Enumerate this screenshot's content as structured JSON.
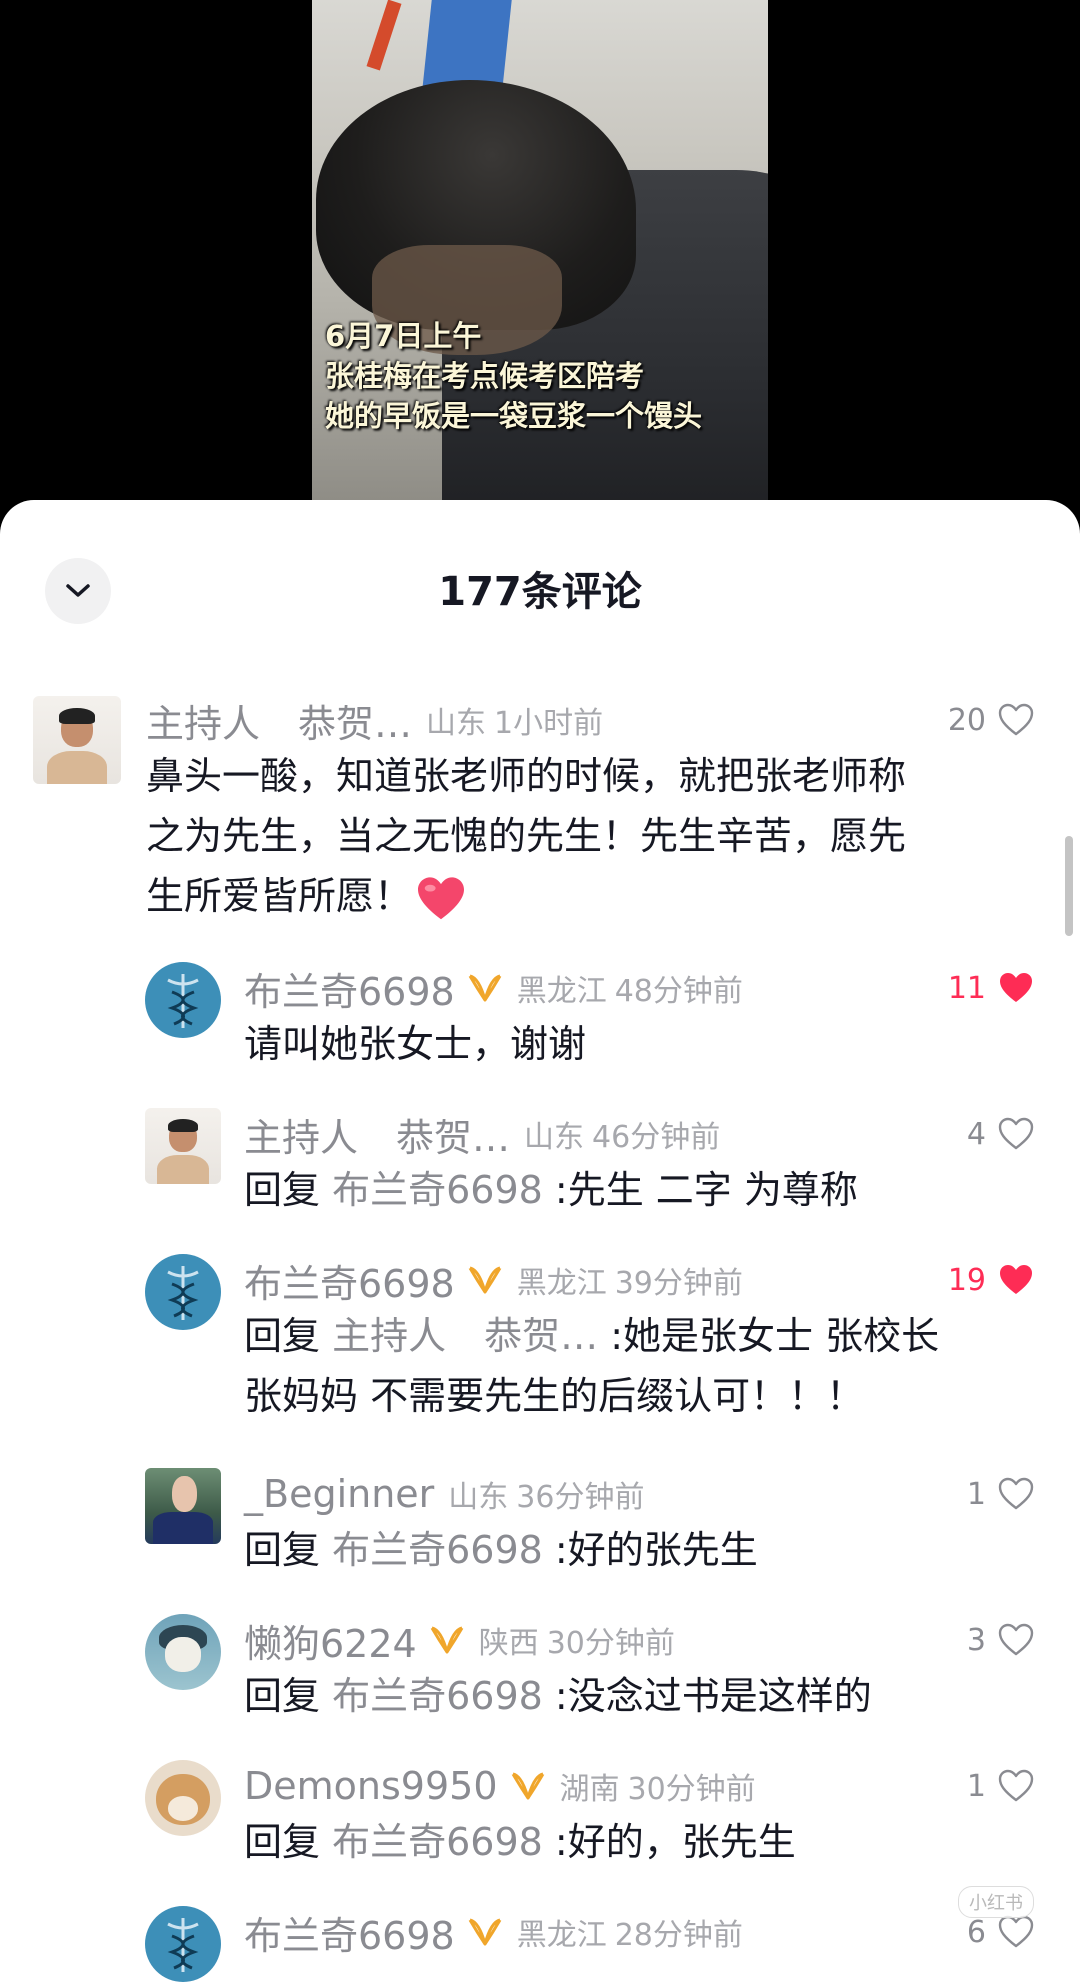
{
  "video": {
    "caption_lines": [
      "6月7日上午",
      "张桂梅在考点候考区陪考",
      "她的早饭是一袋豆浆一个馒头"
    ]
  },
  "sheet": {
    "title": "177条评论"
  },
  "comments": [
    {
      "user": "主持人　恭贺…",
      "location": "山东",
      "time": "1小时前",
      "text": "鼻头一酸，知道张老师的时候，就把张老师称之为先生，当之无愧的先生！先生辛苦，愿先生所爱皆所愿！",
      "text_lines": [
        "鼻头一酸，知道张老师的时候，就把张老师称",
        "之为先生，当之无愧的先生！先生辛苦，愿先",
        "生所爱皆所愿！"
      ],
      "likes": "20",
      "liked": false
    },
    {
      "user": "布兰奇6698",
      "location": "黑龙江",
      "time": "48分钟前",
      "text": "请叫她张女士，谢谢",
      "likes": "11",
      "liked": true
    },
    {
      "user": "主持人　恭贺…",
      "location": "山东",
      "time": "46分钟前",
      "reply_prefix": "回复",
      "reply_to": "布兰奇6698",
      "text": ":先生 二字 为尊称",
      "likes": "4",
      "liked": false
    },
    {
      "user": "布兰奇6698",
      "location": "黑龙江",
      "time": "39分钟前",
      "reply_prefix": "回复",
      "reply_to": "主持人　恭贺…",
      "text": ":她是张女士 张校长",
      "text_line2": "张妈妈 不需要先生的后缀认可！！！",
      "likes": "19",
      "liked": true
    },
    {
      "user": "_Beginner",
      "location": "山东",
      "time": "36分钟前",
      "reply_prefix": "回复",
      "reply_to": "布兰奇6698",
      "text": ":好的张先生",
      "likes": "1",
      "liked": false
    },
    {
      "user": "懒狗6224",
      "location": "陕西",
      "time": "30分钟前",
      "reply_prefix": "回复",
      "reply_to": "布兰奇6698",
      "text": ":没念过书是这样的",
      "likes": "3",
      "liked": false
    },
    {
      "user": "Demons9950",
      "location": "湖南",
      "time": "30分钟前",
      "reply_prefix": "回复",
      "reply_to": "布兰奇6698",
      "text": ":好的，张先生",
      "likes": "1",
      "liked": false
    },
    {
      "user": "布兰奇6698",
      "location": "黑龙江",
      "time": "28分钟前",
      "likes": "6",
      "liked": false
    }
  ],
  "watermark": "小红书",
  "colors": {
    "liked_red": "#fe2c55",
    "username_gray": "#8a8b91",
    "text_dark": "#161823",
    "badge_gold": "#f0a62b"
  },
  "icons": {
    "collapse": "chevron-down-icon",
    "like": "heart-icon",
    "badge": "fan-badge-icon"
  }
}
